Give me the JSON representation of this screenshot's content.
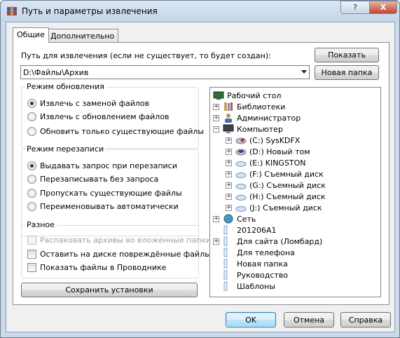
{
  "window": {
    "title": "Путь и параметры извлечения",
    "help_label": "?",
    "close_label": "X"
  },
  "tabs": [
    {
      "label": "Общие",
      "active": true
    },
    {
      "label": "Дополнительно",
      "active": false
    }
  ],
  "path": {
    "label": "Путь для извлечения (если не существует, то будет создан):",
    "value": "D:\\Файлы\\Архив",
    "show_button": "Показать",
    "new_folder_button": "Новая папка"
  },
  "update_mode": {
    "title": "Режим обновления",
    "options": [
      {
        "label": "Извлечь с заменой файлов",
        "checked": true
      },
      {
        "label": "Извлечь с обновлением файлов",
        "checked": false
      },
      {
        "label": "Обновить только существующие файлы",
        "checked": false
      }
    ]
  },
  "overwrite_mode": {
    "title": "Режим перезаписи",
    "options": [
      {
        "label": "Выдавать запрос при перезаписи",
        "checked": true
      },
      {
        "label": "Перезаписывать без запроса",
        "checked": false
      },
      {
        "label": "Пропускать существующие файлы",
        "checked": false
      },
      {
        "label": "Переименовывать автоматически",
        "checked": false
      }
    ]
  },
  "misc": {
    "title": "Разное",
    "options": [
      {
        "label": "Распаковать архивы во вложенные папки",
        "checked": false,
        "disabled": true
      },
      {
        "label": "Оставить на диске повреждённые файлы",
        "checked": false,
        "disabled": false
      },
      {
        "label": "Показать файлы в Проводнике",
        "checked": false,
        "disabled": false
      }
    ]
  },
  "save_button": "Сохранить установки",
  "tree": [
    {
      "label": "Рабочий стол",
      "icon": "desktop-icon",
      "expander": "none"
    },
    {
      "label": "Библиотеки",
      "icon": "libraries-icon",
      "expander": "+"
    },
    {
      "label": "Администратор",
      "icon": "user-icon",
      "expander": "+"
    },
    {
      "label": "Компьютер",
      "icon": "computer-icon",
      "expander": "-"
    },
    {
      "label": "(C:) SysKDFX",
      "icon": "hard-drive-icon",
      "expander": "+"
    },
    {
      "label": "(D:) Новый том",
      "icon": "hard-drive-icon",
      "expander": "+"
    },
    {
      "label": "(E:) KINGSTON",
      "icon": "removable-drive-icon",
      "expander": "+"
    },
    {
      "label": "(F:) Съемный диск",
      "icon": "removable-drive-icon",
      "expander": "+"
    },
    {
      "label": "(G:) Съемный диск",
      "icon": "removable-drive-icon",
      "expander": "+"
    },
    {
      "label": "(H:) Съемный диск",
      "icon": "removable-drive-icon",
      "expander": "+"
    },
    {
      "label": "(J:) Съемный диск",
      "icon": "removable-drive-icon",
      "expander": "+"
    },
    {
      "label": "Сеть",
      "icon": "network-icon",
      "expander": "+"
    },
    {
      "label": "201206A1",
      "icon": "folder-icon",
      "expander": "none"
    },
    {
      "label": "Для сайта (Ломбард)",
      "icon": "folder-icon",
      "expander": "+"
    },
    {
      "label": "Для телефона",
      "icon": "folder-icon",
      "expander": "none"
    },
    {
      "label": "Новая папка",
      "icon": "folder-icon",
      "expander": "none"
    },
    {
      "label": "Руководство",
      "icon": "folder-icon",
      "expander": "none"
    },
    {
      "label": "Шаблоны",
      "icon": "folder-icon",
      "expander": "none"
    }
  ],
  "buttons": {
    "ok": "OK",
    "cancel": "Отмена",
    "help": "Справка"
  }
}
